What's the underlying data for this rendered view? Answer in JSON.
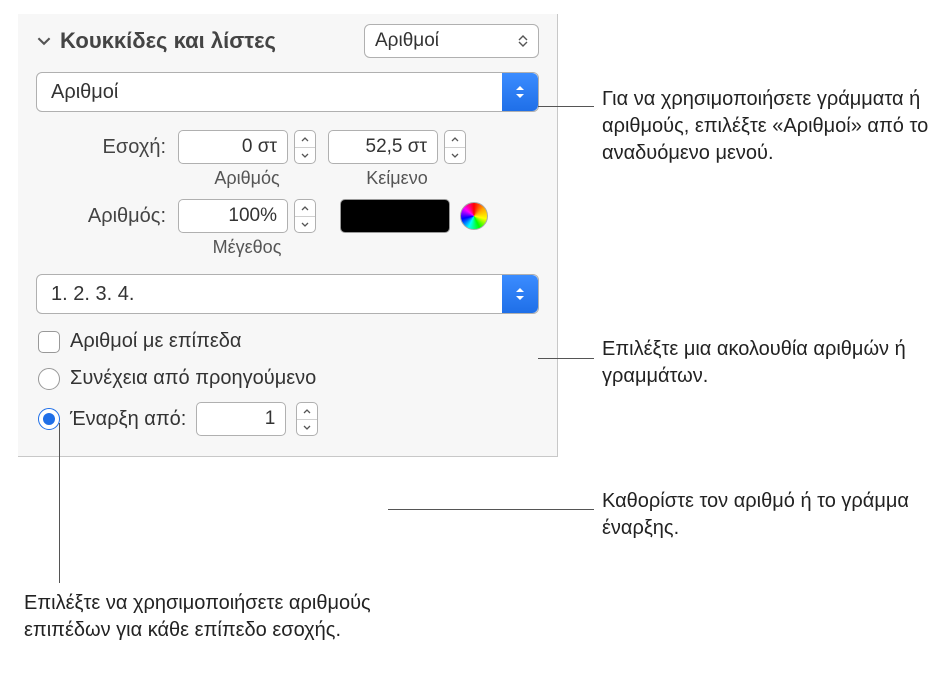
{
  "section_title": "Κουκκίδες και λίστες",
  "top_popup": "Αριθμοί",
  "style_popup": "Αριθμοί",
  "indent": {
    "label": "Εσοχή:",
    "number_value": "0 στ",
    "number_label": "Αριθμός",
    "text_value": "52,5 στ",
    "text_label": "Κείμενο"
  },
  "number_size": {
    "label": "Αριθμός:",
    "value": "100%",
    "sublabel": "Μέγεθος"
  },
  "sequence_popup": "1. 2. 3. 4.",
  "tiered_checkbox_label": "Αριθμοί με επίπεδα",
  "continue_radio_label": "Συνέχεια από προηγούμενο",
  "start_radio_label": "Έναρξη από:",
  "start_value": "1",
  "callouts": {
    "c1": "Για να χρησιμοποιήσετε γράμματα ή αριθμούς, επιλέξτε «Αριθμοί» από το αναδυόμενο μενού.",
    "c2": "Επιλέξτε μια ακολουθία αριθμών ή γραμμάτων.",
    "c3": "Καθορίστε τον αριθμό ή το γράμμα έναρξης.",
    "c4": "Επιλέξτε να χρησιμοποιήσετε αριθμούς επιπέδων για κάθε επίπεδο εσοχής."
  }
}
